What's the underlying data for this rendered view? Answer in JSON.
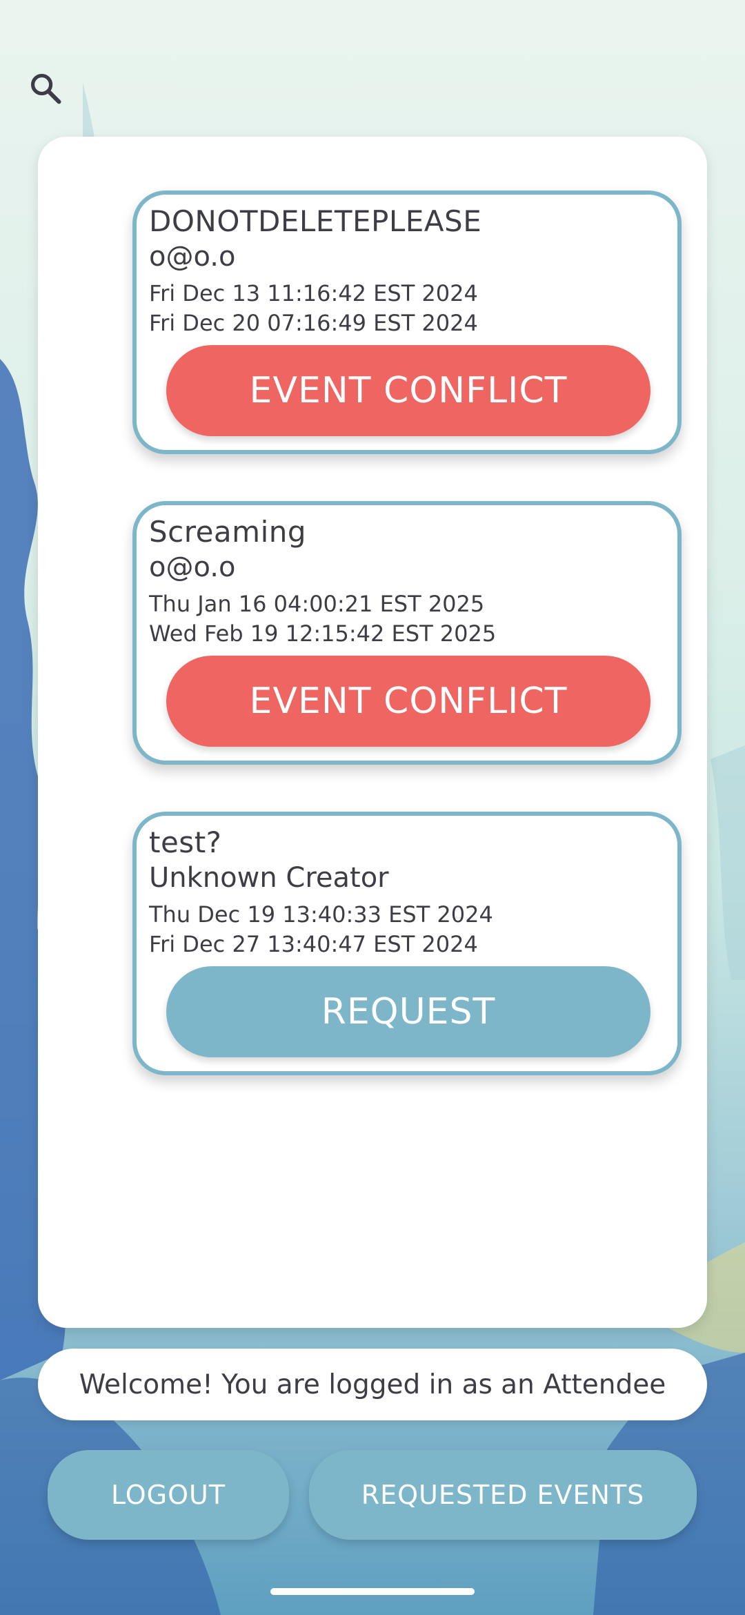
{
  "header": {
    "search_icon": "search-icon"
  },
  "events": [
    {
      "title": "DONOTDELETEPLEASE",
      "creator": "o@o.o",
      "start": "Fri Dec 13 11:16:42 EST 2024",
      "end": "Fri Dec 20 07:16:49 EST 2024",
      "action_label": "EVENT CONFLICT",
      "action_type": "conflict"
    },
    {
      "title": "Screaming",
      "creator": "o@o.o",
      "start": "Thu Jan 16 04:00:21 EST 2025",
      "end": "Wed Feb 19 12:15:42 EST 2025",
      "action_label": "EVENT CONFLICT",
      "action_type": "conflict"
    },
    {
      "title": "test?",
      "creator": "Unknown Creator",
      "start": "Thu Dec 19 13:40:33 EST 2024",
      "end": "Fri Dec 27 13:40:47 EST 2024",
      "action_label": "REQUEST",
      "action_type": "request"
    }
  ],
  "status": {
    "welcome_text": "Welcome! You are logged in as an Attendee"
  },
  "footer": {
    "logout_label": "LOGOUT",
    "requested_events_label": "REQUESTED EVENTS"
  },
  "colors": {
    "accent": "#7db6c8",
    "conflict": "#ef6561",
    "text": "#3d3d45"
  }
}
